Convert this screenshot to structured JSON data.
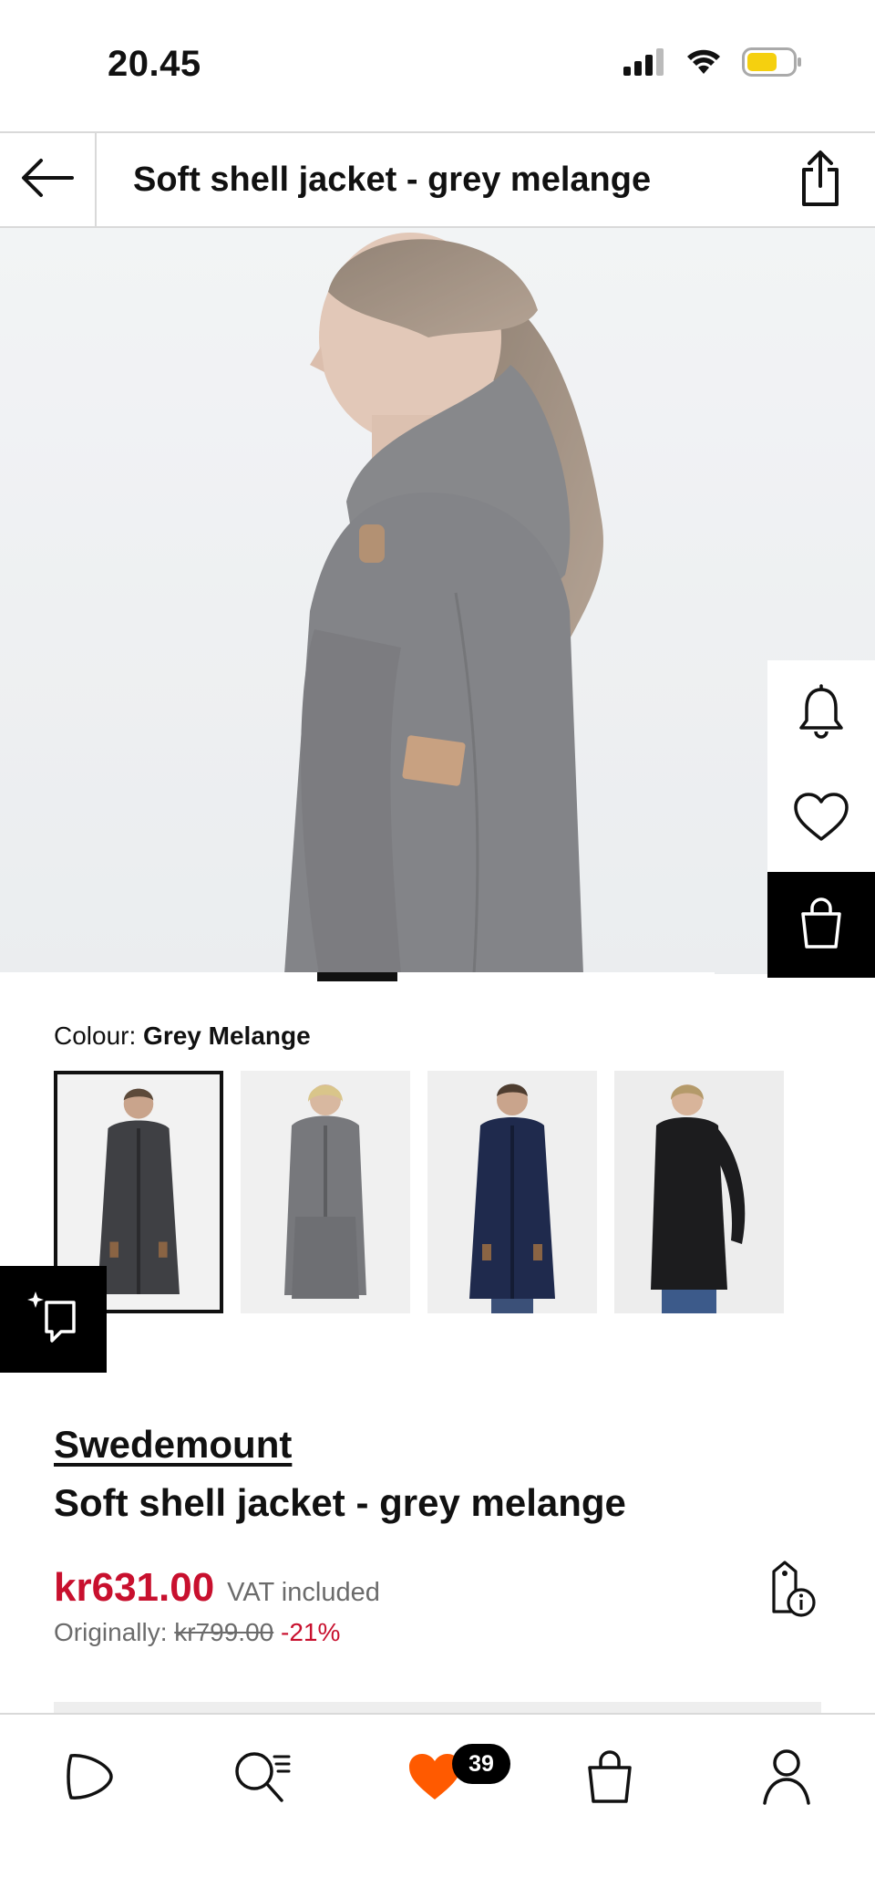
{
  "status_bar": {
    "time": "20.45"
  },
  "header": {
    "title": "Soft shell jacket - grey melange"
  },
  "hero": {
    "image_alt": "Model wearing grey melange soft shell jacket, side view",
    "progress": 0.11
  },
  "colour": {
    "label": "Colour:",
    "value": "Grey Melange",
    "options": [
      {
        "name": "Grey Melange",
        "selected": true
      },
      {
        "name": "Grey",
        "selected": false
      },
      {
        "name": "Navy",
        "selected": false
      },
      {
        "name": "Black",
        "selected": false
      }
    ]
  },
  "product": {
    "brand": "Swedemount",
    "name": "Soft shell jacket - grey melange",
    "price": "kr631.00",
    "vat_note": "VAT included",
    "originally_label": "Originally:",
    "original_price": "kr799.00",
    "discount": "-21%"
  },
  "bottom_nav": {
    "items": [
      "home-icon",
      "search-icon",
      "wishlist-icon",
      "bag-icon",
      "account-icon"
    ],
    "wishlist_count": "39"
  },
  "colors": {
    "sale_red": "#c8102e",
    "heart_orange": "#ff5a00",
    "black": "#000000"
  }
}
